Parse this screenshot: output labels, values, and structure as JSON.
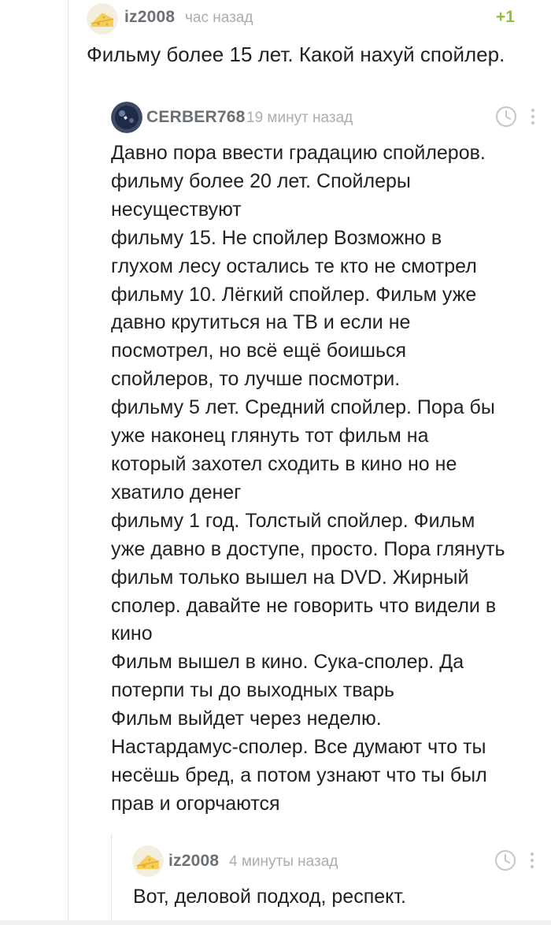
{
  "comments": {
    "first": {
      "author": "iz2008",
      "time": "час назад",
      "rating": "+1",
      "text": "Фильму более 15 лет. Какой нахуй спойлер."
    },
    "second": {
      "author": "CERBER768",
      "time": "19 минут назад",
      "lines": [
        "Давно пора ввести градацию спойлеров.",
        "фильму более 20 лет. Спойлеры",
        "несуществуют",
        "фильму 15. Не спойлер Возможно в",
        "глухом лесу остались те кто не смотрел",
        "фильму 10. Лёгкий спойлер. Фильм уже",
        "давно крутиться на ТВ и если не",
        "посмотрел, но всё ещё боишься",
        "спойлеров, то лучше посмотри.",
        "фильму 5 лет. Средний спойлер. Пора бы",
        "уже наконец глянуть тот фильм на",
        "который захотел сходить в кино но не",
        "хватило денег",
        "фильму 1 год. Толстый спойлер. Фильм",
        "уже давно в доступе, просто. Пора глянуть",
        "фильм только вышел на DVD. Жирный",
        "сполер. давайте не говорить что видели в",
        "кино",
        "Фильм вышел в кино. Сука-сполер. Да",
        "потерпи ты до выходных тварь",
        "Фильм выйдет через неделю.",
        "Настардамус-сполер. Все думают что ты",
        "несёшь бред, а потом узнают что ты был",
        "прав и огорчаются"
      ]
    },
    "third": {
      "author": "iz2008",
      "time": "4 минуты назад",
      "text": "Вот, деловой подход, респект."
    }
  },
  "icons": {
    "avatar_iz2008": "cheese-avatar",
    "avatar_cerber": "berry-avatar",
    "clock": "clock-icon"
  },
  "colors": {
    "author": "#6b7075",
    "time": "#a9adb1",
    "rating": "#8fbf3b",
    "text": "#222222"
  }
}
